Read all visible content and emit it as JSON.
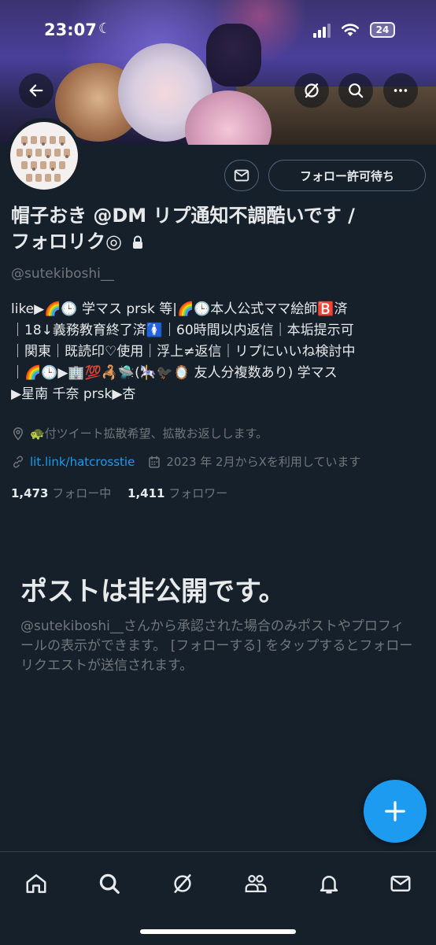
{
  "status_bar": {
    "time": "23:07",
    "battery": "24"
  },
  "header": {
    "back_icon": "arrow-left-icon",
    "grok_icon": "grok-icon",
    "search_icon": "search-icon",
    "more_icon": "more-horizontal-icon"
  },
  "profile": {
    "name_line1": "帽子おき @DM リプ通知不調酷いです /",
    "name_line2": "フォロリク◎",
    "handle": "@sutekiboshi__",
    "message_icon": "mail-icon",
    "follow_button": "フォロー許可待ち",
    "bio_lines": [
      "like▶🌈🕒 学マス prsk 等|🌈🕒本人公式ママ絵師🅱️済",
      "｜18↓義務教育終了済🚺｜60時間以内返信｜本垢提示可",
      "｜関東｜既読印♡使用｜浮上≠返信｜リプにいいね検討中",
      "｜🌈🕒▶🏢💯🦂🛸(🎠🐦‍⬛🪞 友人分複数あり) 学マス",
      "▶星南 千奈 prsk▶杏"
    ],
    "location": "🐢付ツイート拡散希望、拡散お返しします。",
    "link": "lit.link/hatcrosstie",
    "joined": "2023 年 2月からXを利用しています",
    "following_count": "1,473",
    "following_label": "フォロー中",
    "followers_count": "1,411",
    "followers_label": "フォロワー"
  },
  "private_notice": {
    "title": "ポストは非公開です。",
    "description": "@sutekiboshi__さんから承認された場合のみポストやプロフィールの表示ができます。 [フォローする] をタップするとフォローリクエストが送信されます。"
  },
  "tab_bar": {
    "items": [
      "home-icon",
      "search-icon",
      "grok-icon",
      "communities-icon",
      "notifications-icon",
      "messages-icon"
    ]
  },
  "colors": {
    "accent": "#1d9bf0",
    "background": "#15202b",
    "secondary_text": "#71767b"
  }
}
